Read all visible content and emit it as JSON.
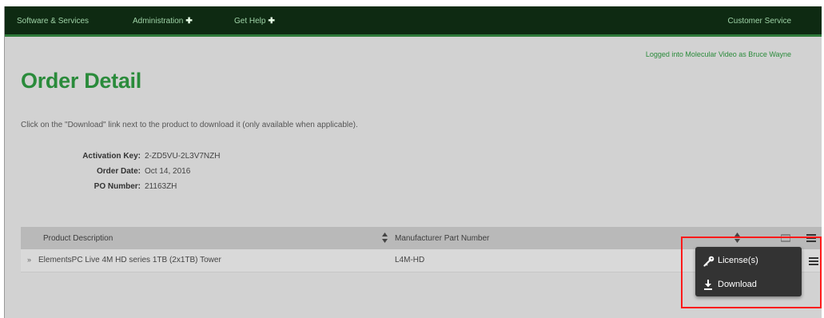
{
  "nav": {
    "items": [
      "Software & Services",
      "Administration",
      "Get Help"
    ],
    "plus": "✚",
    "customer_service": "Customer Service"
  },
  "header": {
    "logged_in": "Logged into Molecular Video as Bruce Wayne"
  },
  "page": {
    "title": "Order Detail",
    "instructions": "Click on the \"Download\" link next to the product to download it (only available when applicable)."
  },
  "order": {
    "activation_key_label": "Activation Key:",
    "activation_key": "2-ZD5VU-2L3V7NZH",
    "order_date_label": "Order Date:",
    "order_date": "Oct 14, 2016",
    "po_number_label": "PO Number:",
    "po_number": "21163ZH"
  },
  "table": {
    "columns": [
      "Product Description",
      "Manufacturer Part Number"
    ],
    "rows": [
      {
        "expand": "»",
        "description": "ElementsPC Live 4M HD series 1TB (2x1TB) Tower",
        "part_number": "L4M-HD"
      }
    ]
  },
  "action_menu": {
    "items": [
      {
        "label": "License(s)",
        "icon": "key-icon"
      },
      {
        "label": "Download",
        "icon": "download-icon"
      }
    ]
  },
  "colors": {
    "brand_green": "#2a8b3b",
    "nav_bg": "#0e2a12",
    "highlight": "#ff1a1a"
  }
}
